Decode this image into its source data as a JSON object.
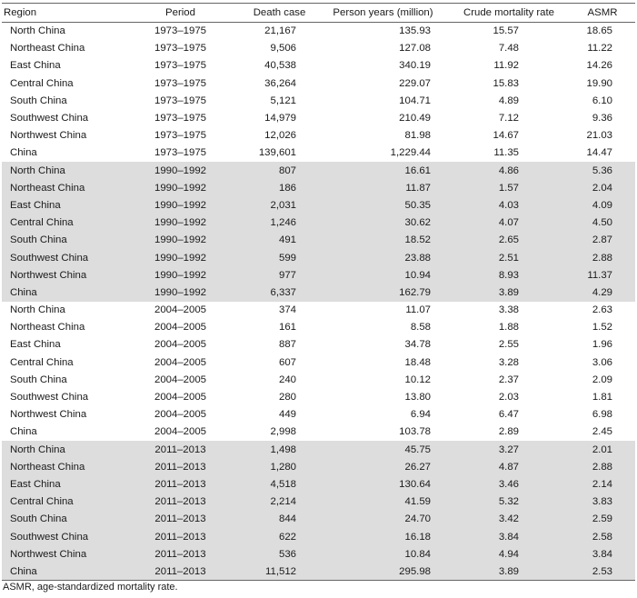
{
  "table": {
    "headers": [
      "Region",
      "Period",
      "Death case",
      "Person years (million)",
      "Crude mortality rate",
      "ASMR"
    ],
    "groups": [
      {
        "shaded": false,
        "rows": [
          [
            "North China",
            "1973–1975",
            "21,167",
            "135.93",
            "15.57",
            "18.65"
          ],
          [
            "Northeast China",
            "1973–1975",
            "9,506",
            "127.08",
            "7.48",
            "11.22"
          ],
          [
            "East China",
            "1973–1975",
            "40,538",
            "340.19",
            "11.92",
            "14.26"
          ],
          [
            "Central China",
            "1973–1975",
            "36,264",
            "229.07",
            "15.83",
            "19.90"
          ],
          [
            "South China",
            "1973–1975",
            "5,121",
            "104.71",
            "4.89",
            "6.10"
          ],
          [
            "Southwest China",
            "1973–1975",
            "14,979",
            "210.49",
            "7.12",
            "9.36"
          ],
          [
            "Northwest China",
            "1973–1975",
            "12,026",
            "81.98",
            "14.67",
            "21.03"
          ],
          [
            "China",
            "1973–1975",
            "139,601",
            "1,229.44",
            "11.35",
            "14.47"
          ]
        ]
      },
      {
        "shaded": true,
        "rows": [
          [
            "North China",
            "1990–1992",
            "807",
            "16.61",
            "4.86",
            "5.36"
          ],
          [
            "Northeast China",
            "1990–1992",
            "186",
            "11.87",
            "1.57",
            "2.04"
          ],
          [
            "East China",
            "1990–1992",
            "2,031",
            "50.35",
            "4.03",
            "4.09"
          ],
          [
            "Central China",
            "1990–1992",
            "1,246",
            "30.62",
            "4.07",
            "4.50"
          ],
          [
            "South China",
            "1990–1992",
            "491",
            "18.52",
            "2.65",
            "2.87"
          ],
          [
            "Southwest China",
            "1990–1992",
            "599",
            "23.88",
            "2.51",
            "2.88"
          ],
          [
            "Northwest China",
            "1990–1992",
            "977",
            "10.94",
            "8.93",
            "11.37"
          ],
          [
            "China",
            "1990–1992",
            "6,337",
            "162.79",
            "3.89",
            "4.29"
          ]
        ]
      },
      {
        "shaded": false,
        "rows": [
          [
            "North China",
            "2004–2005",
            "374",
            "11.07",
            "3.38",
            "2.63"
          ],
          [
            "Northeast China",
            "2004–2005",
            "161",
            "8.58",
            "1.88",
            "1.52"
          ],
          [
            "East China",
            "2004–2005",
            "887",
            "34.78",
            "2.55",
            "1.96"
          ],
          [
            "Central China",
            "2004–2005",
            "607",
            "18.48",
            "3.28",
            "3.06"
          ],
          [
            "South China",
            "2004–2005",
            "240",
            "10.12",
            "2.37",
            "2.09"
          ],
          [
            "Southwest China",
            "2004–2005",
            "280",
            "13.80",
            "2.03",
            "1.81"
          ],
          [
            "Northwest China",
            "2004–2005",
            "449",
            "6.94",
            "6.47",
            "6.98"
          ],
          [
            "China",
            "2004–2005",
            "2,998",
            "103.78",
            "2.89",
            "2.45"
          ]
        ]
      },
      {
        "shaded": true,
        "rows": [
          [
            "North China",
            "2011–2013",
            "1,498",
            "45.75",
            "3.27",
            "2.01"
          ],
          [
            "Northeast China",
            "2011–2013",
            "1,280",
            "26.27",
            "4.87",
            "2.88"
          ],
          [
            "East China",
            "2011–2013",
            "4,518",
            "130.64",
            "3.46",
            "2.14"
          ],
          [
            "Central China",
            "2011–2013",
            "2,214",
            "41.59",
            "5.32",
            "3.83"
          ],
          [
            "South China",
            "2011–2013",
            "844",
            "24.70",
            "3.42",
            "2.59"
          ],
          [
            "Southwest China",
            "2011–2013",
            "622",
            "16.18",
            "3.84",
            "2.58"
          ],
          [
            "Northwest China",
            "2011–2013",
            "536",
            "10.84",
            "4.94",
            "3.84"
          ],
          [
            "China",
            "2011–2013",
            "11,512",
            "295.98",
            "3.89",
            "2.53"
          ]
        ]
      }
    ],
    "shade_color": "#dddddd",
    "footnote": "ASMR, age-standardized mortality rate."
  }
}
